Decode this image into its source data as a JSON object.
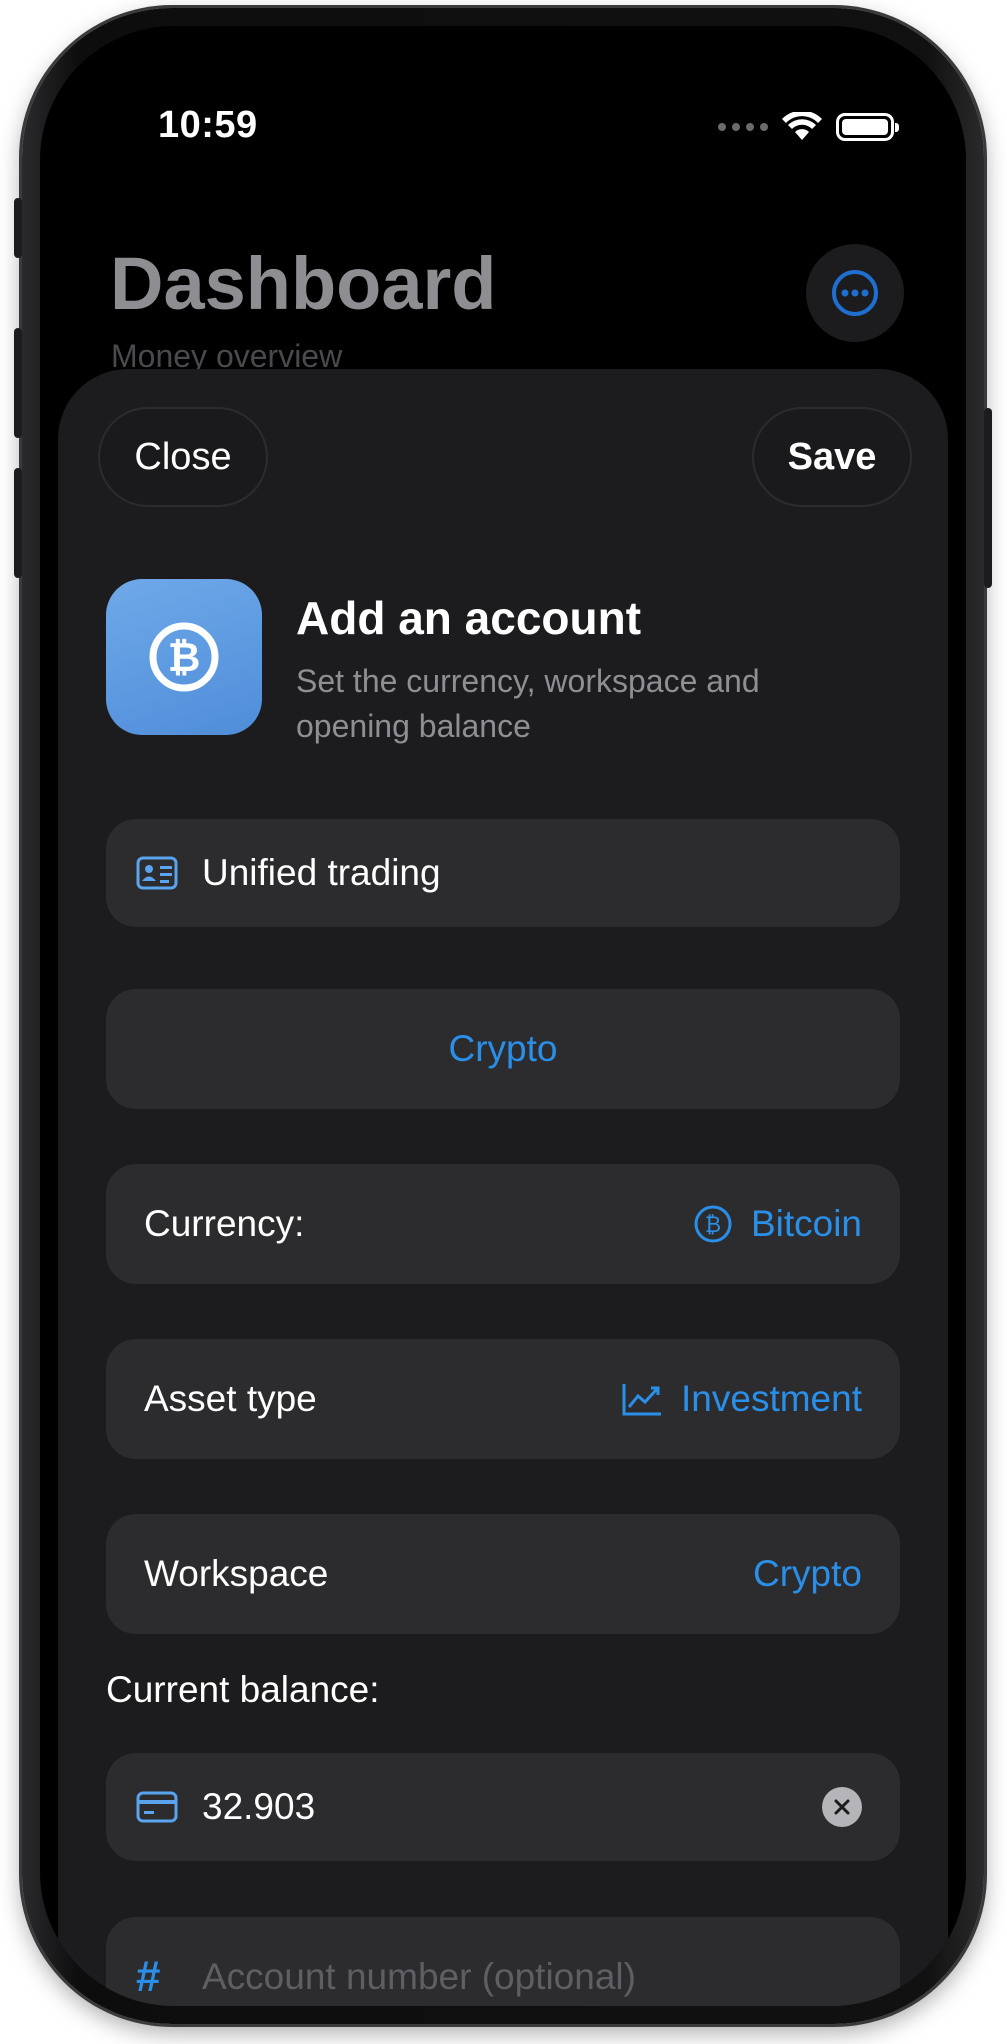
{
  "status_bar": {
    "time": "10:59"
  },
  "background": {
    "title": "Dashboard",
    "subtitle": "Money overview",
    "more_icon": "ellipsis-circle-icon"
  },
  "sheet": {
    "close_label": "Close",
    "save_label": "Save",
    "app_icon": "bitcoin-icon",
    "title": "Add an account",
    "subtitle": "Set the currency, workspace and opening balance",
    "name_field": {
      "icon": "person-card-icon",
      "value": "Unified trading"
    },
    "account_type": "Crypto",
    "currency": {
      "label": "Currency:",
      "icon": "bitcoin-icon",
      "value": "Bitcoin"
    },
    "asset_type": {
      "label": "Asset type",
      "icon": "chart-line-icon",
      "value": "Investment"
    },
    "workspace": {
      "label": "Workspace",
      "value": "Crypto"
    },
    "balance_label": "Current balance:",
    "balance_field": {
      "icon": "credit-card-icon",
      "value": "32.903",
      "clear_icon": "xmark-circle-icon"
    },
    "account_number": {
      "icon": "hash-icon",
      "placeholder": "Account number (optional)"
    }
  },
  "colors": {
    "accent": "#2a8fe8",
    "sheet_bg": "#1c1c1e",
    "row_bg": "#2c2c2e",
    "app_icon_bg": "#5a9ae0"
  }
}
